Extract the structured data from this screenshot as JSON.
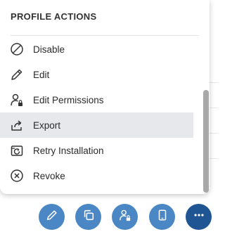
{
  "menu": {
    "title": "PROFILE ACTIONS",
    "items": [
      {
        "label": "Disable",
        "icon": "disable-icon"
      },
      {
        "label": "Edit",
        "icon": "pencil-icon"
      },
      {
        "label": "Edit Permissions",
        "icon": "user-lock-icon"
      },
      {
        "label": "Export",
        "icon": "share-export-icon",
        "active": true
      },
      {
        "label": "Retry Installation",
        "icon": "retry-install-icon"
      },
      {
        "label": "Revoke",
        "icon": "revoke-icon"
      }
    ]
  },
  "fabs": [
    {
      "icon": "pencil-icon"
    },
    {
      "icon": "copy-icon"
    },
    {
      "icon": "user-lock-icon"
    },
    {
      "icon": "device-icon"
    },
    {
      "icon": "more-icon"
    }
  ],
  "colors": {
    "fab_light": "#4a87c4",
    "fab_primary": "#1f5592",
    "active_row": "#e6e8eb"
  }
}
